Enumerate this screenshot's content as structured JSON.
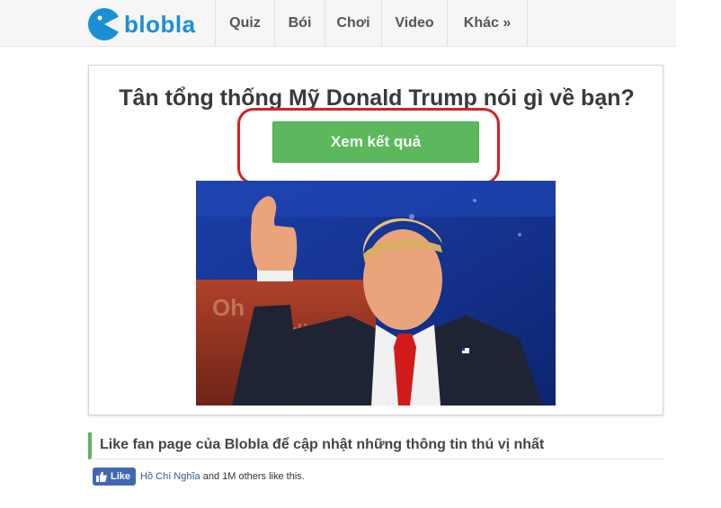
{
  "header": {
    "logo_text": "blobla",
    "nav": [
      {
        "label": "Quiz"
      },
      {
        "label": "Bói"
      },
      {
        "label": "Chơi"
      },
      {
        "label": "Video"
      },
      {
        "label": "Khác »"
      }
    ]
  },
  "quiz": {
    "title": "Tân tổng thống Mỹ Donald Trump nói gì về bạn?",
    "button_label": "Xem kết quả",
    "image_alt": "photo-of-donald-trump-thumbs-up"
  },
  "facebook": {
    "heading": "Like fan page của Blobla để cập nhật những thông tin thú vị nhất",
    "like_label": "Like",
    "friend_name": "Hồ Chí Nghĩa",
    "others_text": "and 1M others like this."
  },
  "colors": {
    "brand_blue": "#1a8fd8",
    "button_green": "#5cb85c",
    "highlight_red": "#d82121",
    "facebook_blue": "#4267b2"
  }
}
